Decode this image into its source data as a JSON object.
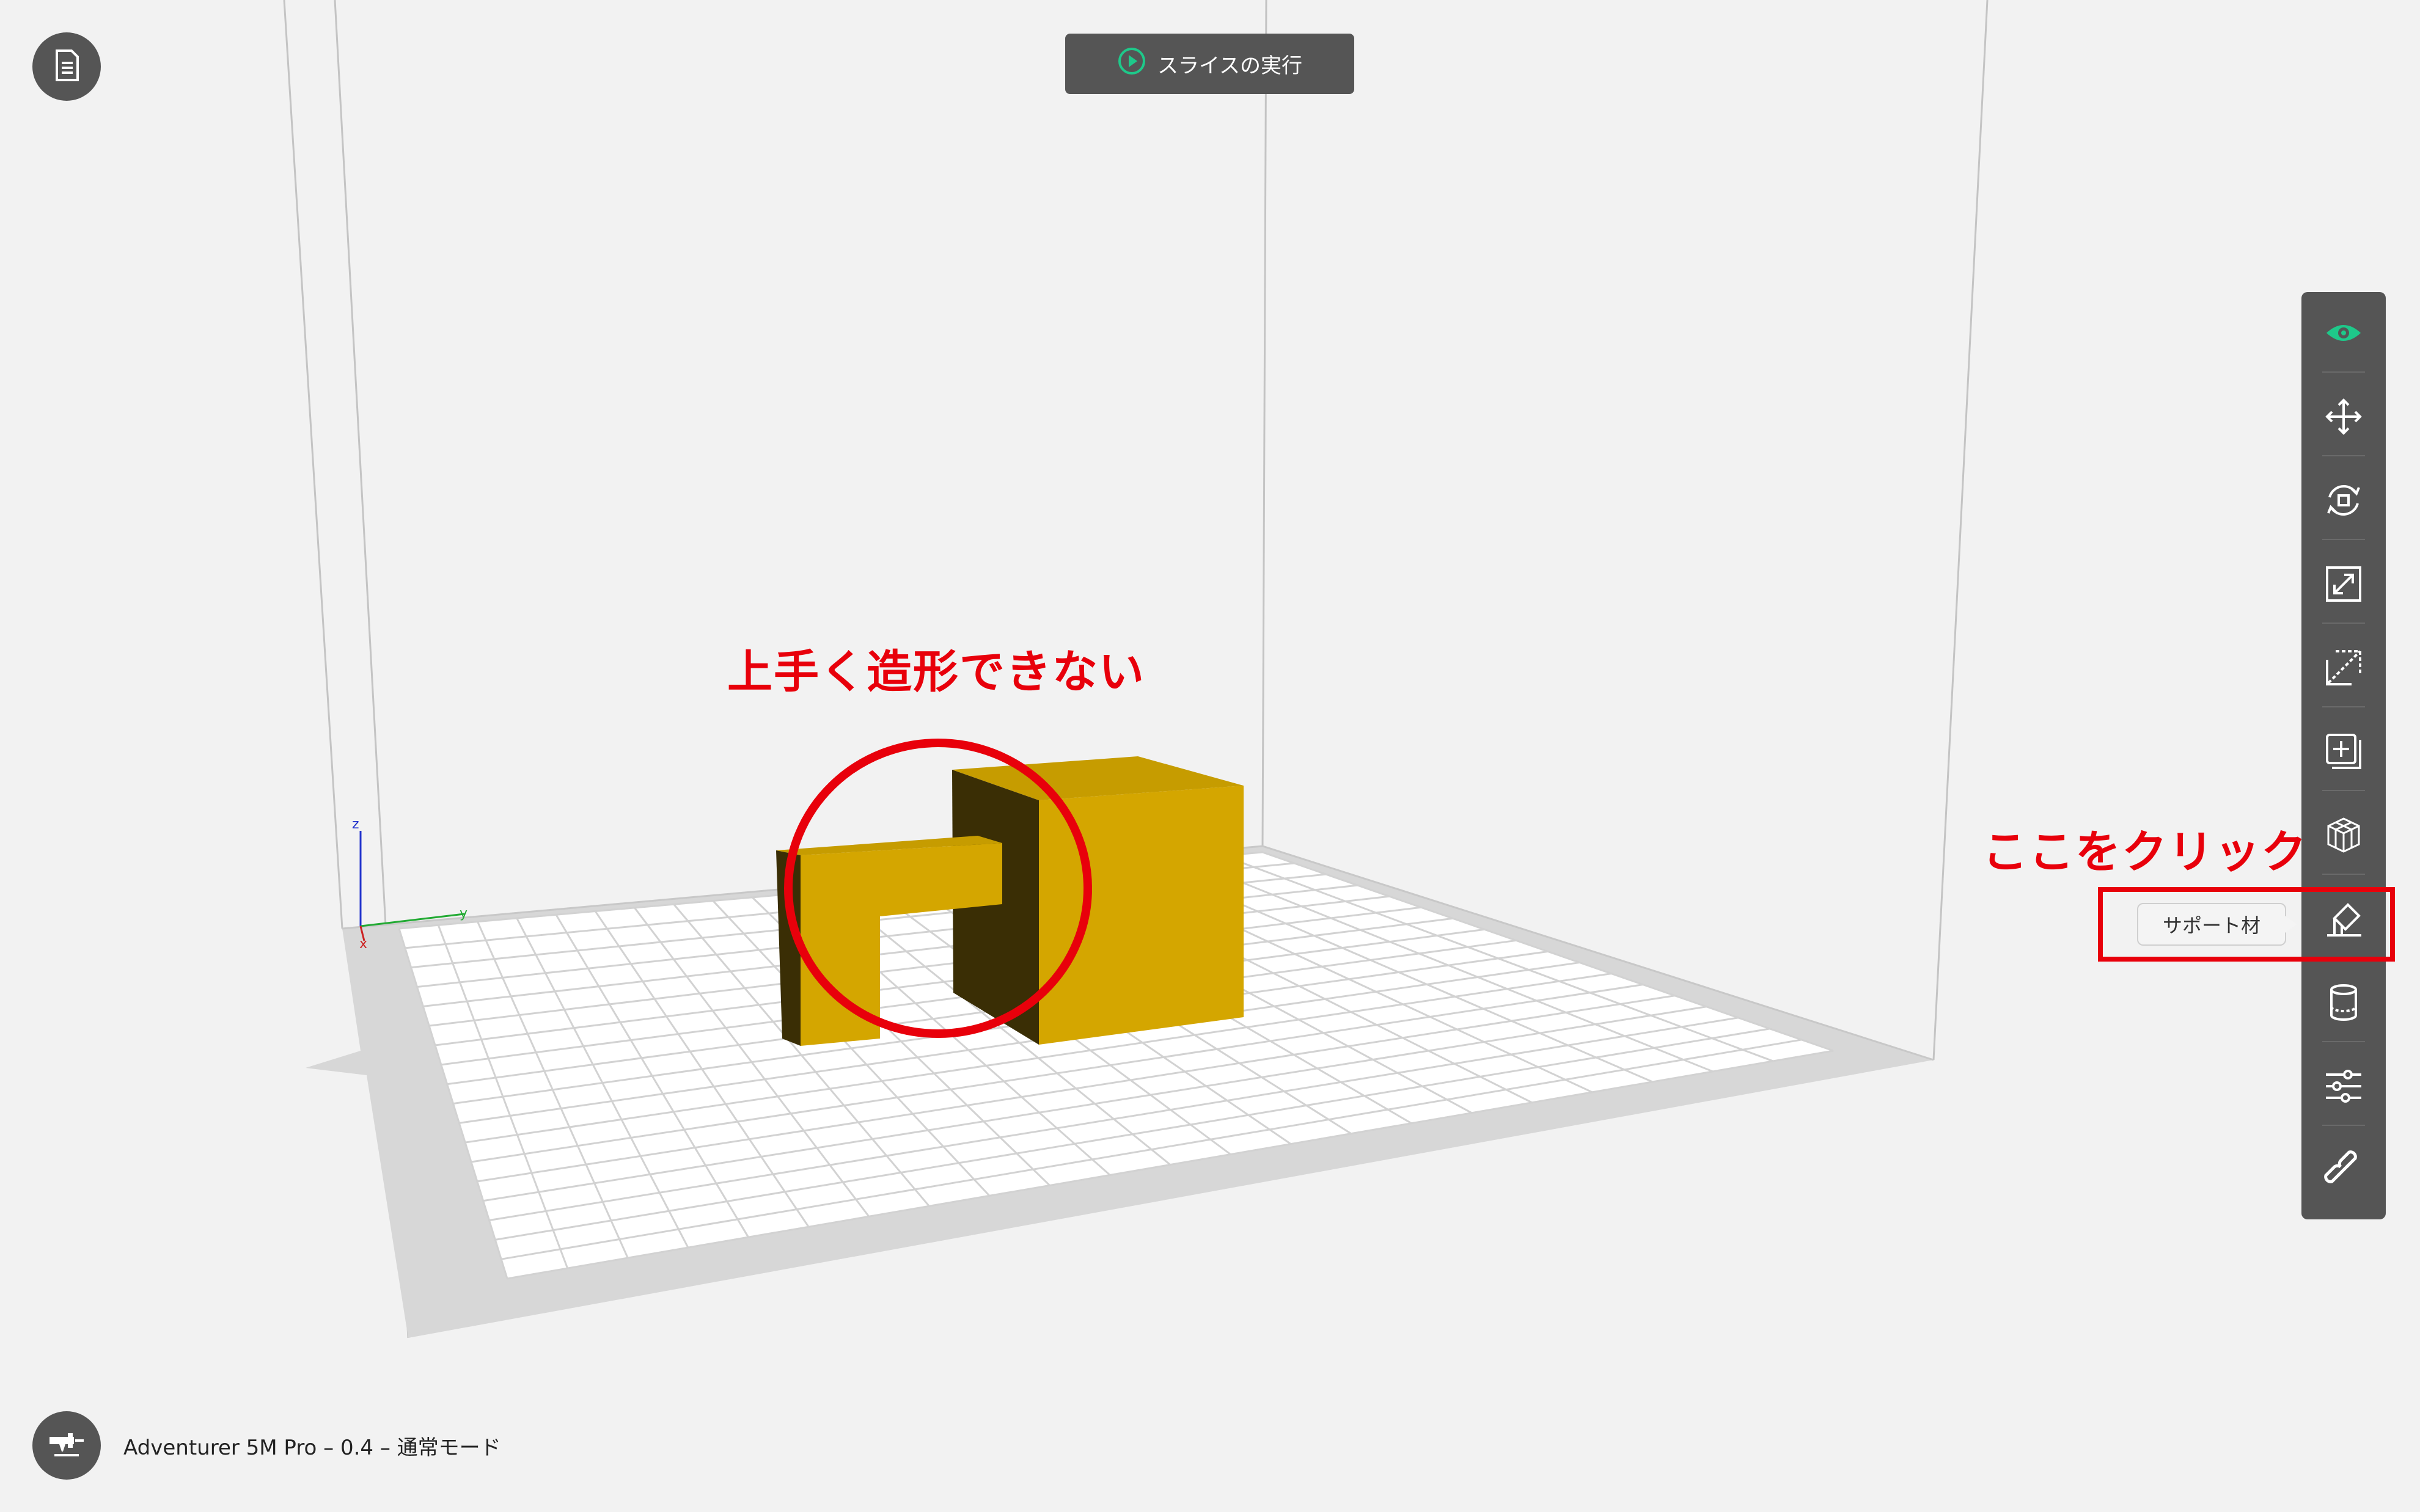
{
  "toolbar_top": {
    "slice_label": "スライスの実行",
    "slice_icon": "play-circle-icon"
  },
  "file_button_icon": "document-icon",
  "status": {
    "printer_icon": "nozzle-icon",
    "printer_info": "Adventurer 5M Pro – 0.4 – 通常モード"
  },
  "viewport": {
    "axis_labels": {
      "x": "x",
      "y": "y",
      "z": "z"
    },
    "model_color": "#d4a600",
    "model_shadow_color": "#3a2e05"
  },
  "side_tools": [
    {
      "id": "view",
      "icon": "eye-icon",
      "active": true
    },
    {
      "id": "move",
      "icon": "move-icon"
    },
    {
      "id": "rotate",
      "icon": "rotate-icon"
    },
    {
      "id": "scale",
      "icon": "scale-icon"
    },
    {
      "id": "cut",
      "icon": "cut-icon"
    },
    {
      "id": "duplicate",
      "icon": "duplicate-icon"
    },
    {
      "id": "layout",
      "icon": "layout-icon"
    },
    {
      "id": "support",
      "icon": "support-icon",
      "tooltip": "サポート材"
    },
    {
      "id": "cylinder",
      "icon": "cylinder-icon"
    },
    {
      "id": "settings",
      "icon": "sliders-icon"
    },
    {
      "id": "link",
      "icon": "link-icon"
    }
  ],
  "annotations": {
    "problem_text": "上手く造形できない",
    "click_text": "ここをクリック",
    "color": "#e8000b"
  },
  "colors": {
    "accent_green": "#1ec98a",
    "toolbar_bg": "#555555"
  }
}
